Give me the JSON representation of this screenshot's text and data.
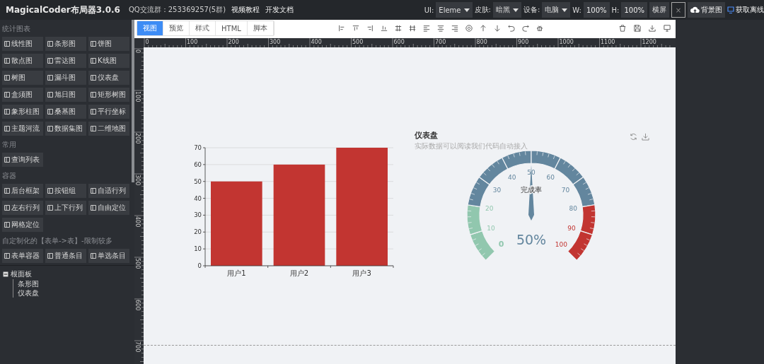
{
  "app_title": "MagicalCoder布局器3.0.6",
  "header_links": [
    {
      "kind": "text",
      "label": "QQ交流群：253369257(5群)"
    },
    {
      "kind": "link",
      "label": "视频教程"
    },
    {
      "kind": "link",
      "label": "开发文档"
    }
  ],
  "settings": [
    {
      "kind": "select",
      "label": "UI:",
      "value": "Eleme"
    },
    {
      "kind": "select",
      "label": "皮肤:",
      "value": "暗黑"
    },
    {
      "kind": "select",
      "label": "设备:",
      "value": "电脑"
    },
    {
      "kind": "input",
      "label": "W:",
      "value": "100%"
    },
    {
      "kind": "input",
      "label": "H:",
      "value": "100%"
    }
  ],
  "header_buttons": [
    {
      "kind": "plain",
      "label": "横屏"
    },
    {
      "kind": "close",
      "label": "×"
    },
    {
      "kind": "cloud",
      "label": "背景图"
    },
    {
      "kind": "check",
      "label": "获取离线"
    }
  ],
  "sidebar": [
    {
      "title": "统计图表",
      "items": [
        "线性图",
        "条形图",
        "饼图",
        "散点图",
        "雷达图",
        "K线图",
        "树图",
        "漏斗图",
        "仪表盘",
        "盒须图",
        "旭日图",
        "矩形树图",
        "象形柱图",
        "桑基图",
        "平行坐标",
        "主题河流",
        "数据集图",
        "二维地图"
      ]
    },
    {
      "title": "常用",
      "items": [
        "查询列表"
      ]
    },
    {
      "title": "容器",
      "items": [
        "后台框架",
        "按钮组",
        "自适行列",
        "左右行列",
        "上下行列",
        "自由定位",
        "网格定位"
      ]
    },
    {
      "title": "自定制化的【表单->表】-限制较多",
      "items": [
        "表单容器",
        "普通条目",
        "单选条目"
      ]
    }
  ],
  "tree": [
    {
      "label": "根面板",
      "expanded": true,
      "children": [
        {
          "label": "条形图"
        },
        {
          "label": "仪表盘"
        }
      ]
    }
  ],
  "tabs": [
    {
      "label": "视图",
      "selected": true
    },
    {
      "label": "预览",
      "selected": false
    },
    {
      "label": "样式",
      "selected": false
    },
    {
      "label": "HTML",
      "selected": false
    },
    {
      "label": "脚本",
      "selected": false
    }
  ],
  "ruler": {
    "x_labels": [
      "0",
      "100",
      "200",
      "300",
      "400",
      "500",
      "600",
      "700",
      "800",
      "900",
      "1000",
      "1100",
      "1200"
    ],
    "y_labels": [
      "0",
      "100",
      "200",
      "300",
      "400",
      "500",
      "600",
      "700"
    ]
  },
  "bar_chart": {
    "chart_data": {
      "type": "bar",
      "categories": [
        "用户1",
        "用户2",
        "用户3"
      ],
      "series": [
        {
          "color": "#c23531",
          "values": [
            50,
            60,
            70
          ]
        }
      ],
      "ylim": [
        0,
        70
      ],
      "yticks": [
        0,
        10,
        20,
        30,
        40,
        50,
        60,
        70
      ],
      "grid": true
    }
  },
  "gauge": {
    "title": "仪表盘",
    "subtitle": "实际数据可以阅读我们代码自动接入",
    "name": "完成率",
    "value_label": "50%",
    "level": 0.5,
    "ticks": [
      {
        "label": "0",
        "color": "#91c7ae"
      },
      {
        "label": "10",
        "color": "#91c7ae"
      },
      {
        "label": "20",
        "color": "#91c7ae"
      },
      {
        "label": "30",
        "color": "#63869e"
      },
      {
        "label": "40",
        "color": "#63869e"
      },
      {
        "label": "50",
        "color": "#63869e"
      },
      {
        "label": "60",
        "color": "#63869e"
      },
      {
        "label": "70",
        "color": "#63869e"
      },
      {
        "label": "80",
        "color": "#63869e"
      },
      {
        "label": "90",
        "color": "#c23531"
      },
      {
        "label": "100",
        "color": "#c23531"
      }
    ]
  }
}
